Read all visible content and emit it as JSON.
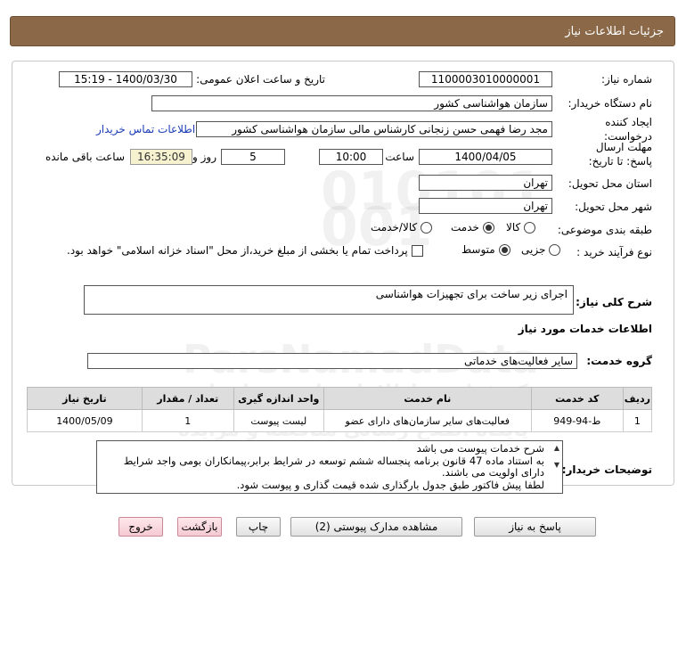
{
  "header": {
    "title": "جزئیات اطلاعات نیاز"
  },
  "fields": {
    "need_number_label": "شماره نیاز:",
    "need_number": "1100003010000001",
    "announce_label": "تاریخ و ساعت اعلان عمومی:",
    "announce_value": "1400/03/30 - 15:19",
    "buyer_org_label": "نام دستگاه خریدار:",
    "buyer_org": "سازمان هواشناسی کشور",
    "creator_label": "ایجاد کننده درخواست:",
    "creator": "مجد رضا فهمی حسن زنجانی کارشناس مالی سازمان هواشناسی کشور",
    "contact_link": "اطلاعات تماس خریدار",
    "deadline_label": "مهلت ارسال پاسخ: تا تاریخ:",
    "deadline_date": "1400/04/05",
    "time_label": "ساعت",
    "deadline_time": "10:00",
    "days_value": "5",
    "days_label": "روز و",
    "remaining_time": "16:35:09",
    "remaining_label": "ساعت باقی مانده",
    "province_label": "استان محل تحویل:",
    "province": "تهران",
    "city_label": "شهر محل تحویل:",
    "city": "تهران",
    "category_label": "طبقه بندی موضوعی:",
    "category_options": [
      "کالا",
      "خدمت",
      "کالا/خدمت"
    ],
    "process_label": "نوع فرآیند خرید :",
    "process_options": [
      "جزیی",
      "متوسط"
    ],
    "payment_note": "پرداخت تمام یا بخشی از مبلغ خرید،از محل \"اسناد خزانه اسلامی\" خواهد بود.",
    "summary_label": "شرح کلی نیاز:",
    "summary": "اجرای زیر ساخت برای تجهیزات هواشناسی",
    "services_heading": "اطلاعات خدمات مورد نیاز",
    "service_group_label": "گروه خدمت:",
    "service_group": "سایر فعالیت‌های خدماتی",
    "buyer_notes_label": "توضیحات خریدار:",
    "buyer_notes": [
      "شرح خدمات پیوست می باشد",
      "به استناد ماده 47 قانون برنامه پنجساله ششم توسعه در شرایط برابر،پیمانکاران بومی واجد شرایط",
      "دارای اولویت می باشند.",
      "لطفا پیش فاکتور طبق جدول بارگذاری شده قیمت گذاری و پیوست شود."
    ]
  },
  "table": {
    "headers": [
      "ردیف",
      "کد خدمت",
      "نام خدمت",
      "واحد اندازه گیری",
      "تعداد / مقدار",
      "تاریخ نیاز"
    ],
    "rows": [
      [
        "1",
        "ط-94-949",
        "فعالیت‌های سایر سازمان‌های دارای عضو",
        "لیست پیوست",
        "1",
        "1400/05/09"
      ]
    ]
  },
  "buttons": {
    "reply": "پاسخ به نیاز",
    "attachments": "مشاهده مدارک پیوستی (2)",
    "print": "چاپ",
    "back": "بازگشت",
    "exit": "خروج"
  },
  "watermark": {
    "logo_text": "ParsNamadData",
    "site_text": "مرکز فراوری اطلاعات پارس نماد داده",
    "sub_text": "پایگاه اطلاع رسانی مناقصه و مزایده"
  }
}
